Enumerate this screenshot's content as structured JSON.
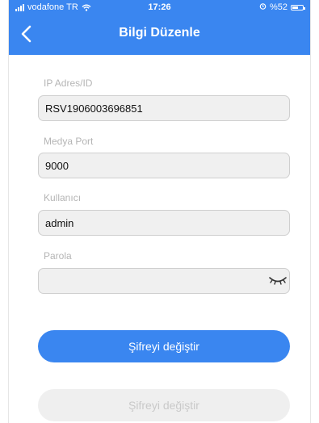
{
  "status_bar": {
    "carrier": "vodafone TR",
    "time": "17:26",
    "battery": "%52"
  },
  "header": {
    "title": "Bilgi Düzenle"
  },
  "form": {
    "ip_label": "IP Adres/ID",
    "ip_value": "RSV1906003696851",
    "port_label": "Medya Port",
    "port_value": "9000",
    "user_label": "Kullanıcı",
    "user_value": "admin",
    "password_label": "Parola",
    "password_value": ""
  },
  "buttons": {
    "change_password_label": "Şifreyi değiştir",
    "secondary_label": "Şifreyi değiştir"
  },
  "colors": {
    "accent": "#3a86f0",
    "field_bg": "#f0f0f0",
    "disabled_bg": "#efefef"
  }
}
